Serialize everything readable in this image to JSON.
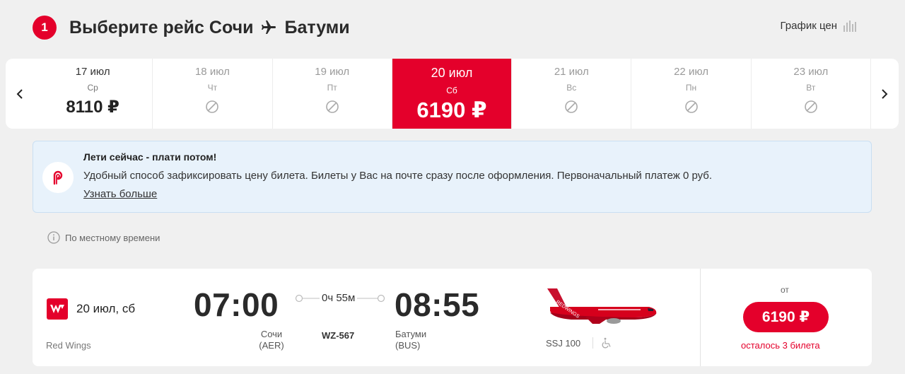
{
  "header": {
    "step": "1",
    "title_prefix": "Выберите рейс",
    "origin": "Сочи",
    "destination": "Батуми",
    "price_graph_label": "График цен"
  },
  "date_strip": {
    "days": [
      {
        "date": "17 июл",
        "weekday": "Ср",
        "price": "8110 ₽",
        "available": true,
        "selected": false
      },
      {
        "date": "18 июл",
        "weekday": "Чт",
        "price": "",
        "available": false,
        "selected": false
      },
      {
        "date": "19 июл",
        "weekday": "Пт",
        "price": "",
        "available": false,
        "selected": false
      },
      {
        "date": "20 июл",
        "weekday": "Сб",
        "price": "6190 ₽",
        "available": true,
        "selected": true
      },
      {
        "date": "21 июл",
        "weekday": "Вс",
        "price": "",
        "available": false,
        "selected": false
      },
      {
        "date": "22 июл",
        "weekday": "Пн",
        "price": "",
        "available": false,
        "selected": false
      },
      {
        "date": "23 июл",
        "weekday": "Вт",
        "price": "",
        "available": false,
        "selected": false
      }
    ]
  },
  "promo": {
    "title": "Лети сейчас - плати потом!",
    "text": "Удобный способ зафиксировать цену билета. Билеты у Вас на почте сразу после оформления. Первоначальный платеж 0 руб.",
    "link": "Узнать больше"
  },
  "local_time_note": "По местному времени",
  "flight": {
    "date": "20 июл, сб",
    "airline": "Red Wings",
    "departure_time": "07:00",
    "arrival_time": "08:55",
    "duration": "0ч 55м",
    "flight_number": "WZ-567",
    "departure_city": "Сочи",
    "departure_code": "(AER)",
    "arrival_city": "Батуми",
    "arrival_code": "(BUS)",
    "aircraft": "SSJ 100",
    "from_label": "от",
    "price": "6190 ₽",
    "seats_left": "осталось 3 билета"
  },
  "colors": {
    "brand_red": "#e4002b",
    "promo_bg": "#e8f2fb",
    "page_bg": "#f0f0f0"
  },
  "icons": {
    "nav_prev": "chevron-left-icon",
    "nav_next": "chevron-right-icon",
    "unavailable": "not-available-icon",
    "price_graph": "bar-chart-icon",
    "info": "info-icon",
    "airline": "red-wings-logo",
    "promo": "podeli-logo",
    "accessibility": "wheelchair-icon"
  }
}
